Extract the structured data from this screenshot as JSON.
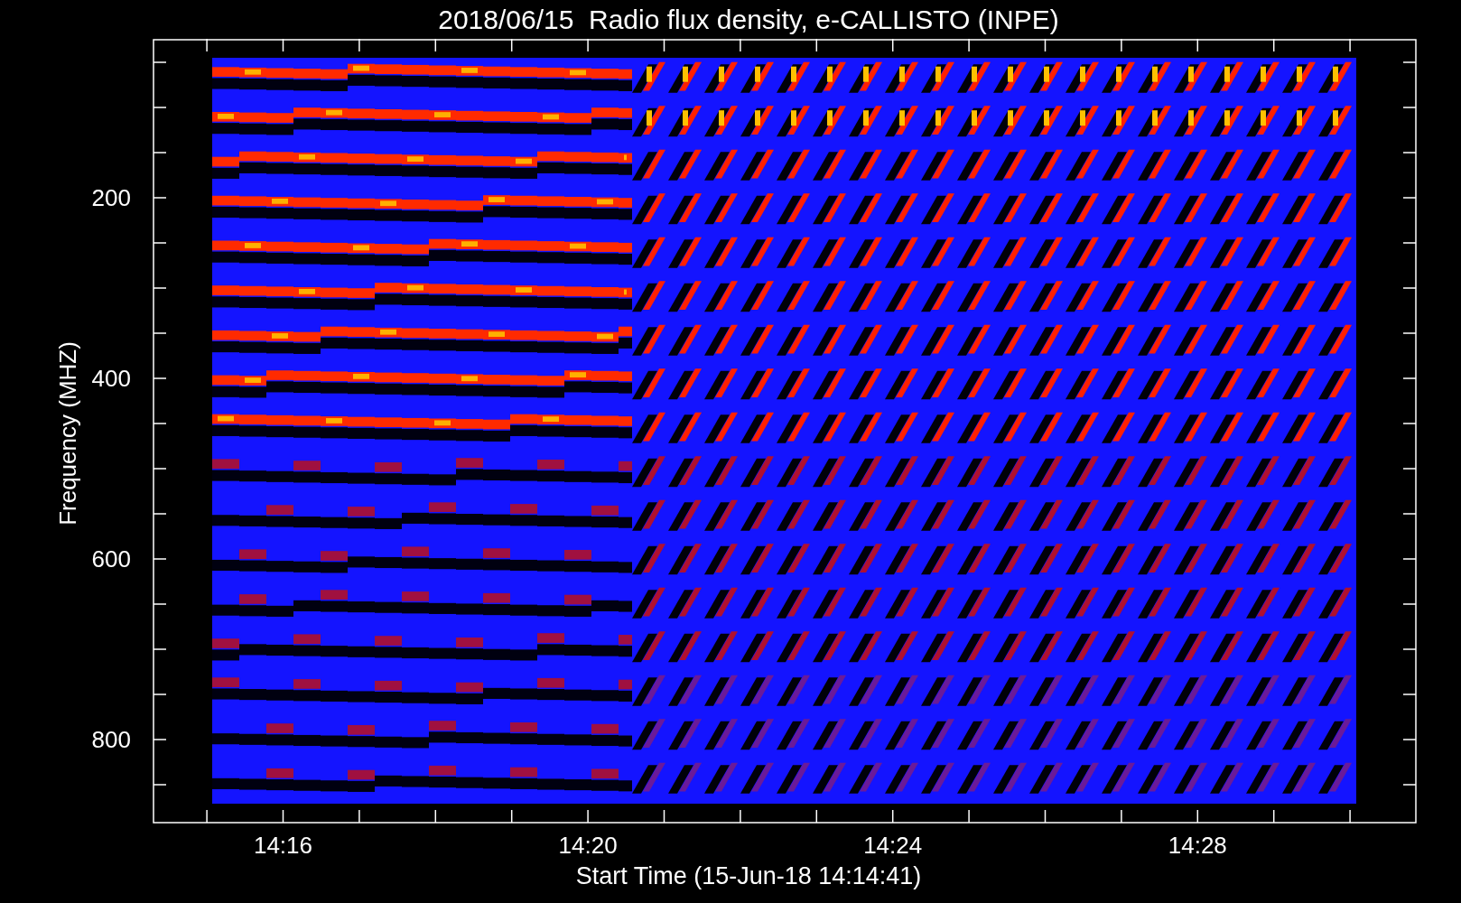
{
  "title": "2018/06/15  Radio flux density, e-CALLISTO (INPE)",
  "y_axis": {
    "label": "Frequency (MHZ)",
    "ticks": [
      "200",
      "400",
      "600",
      "800"
    ]
  },
  "x_axis": {
    "label": "Start Time (15-Jun-18 14:14:41)",
    "ticks": [
      "14:16",
      "14:20",
      "14:24",
      "14:28"
    ]
  }
}
